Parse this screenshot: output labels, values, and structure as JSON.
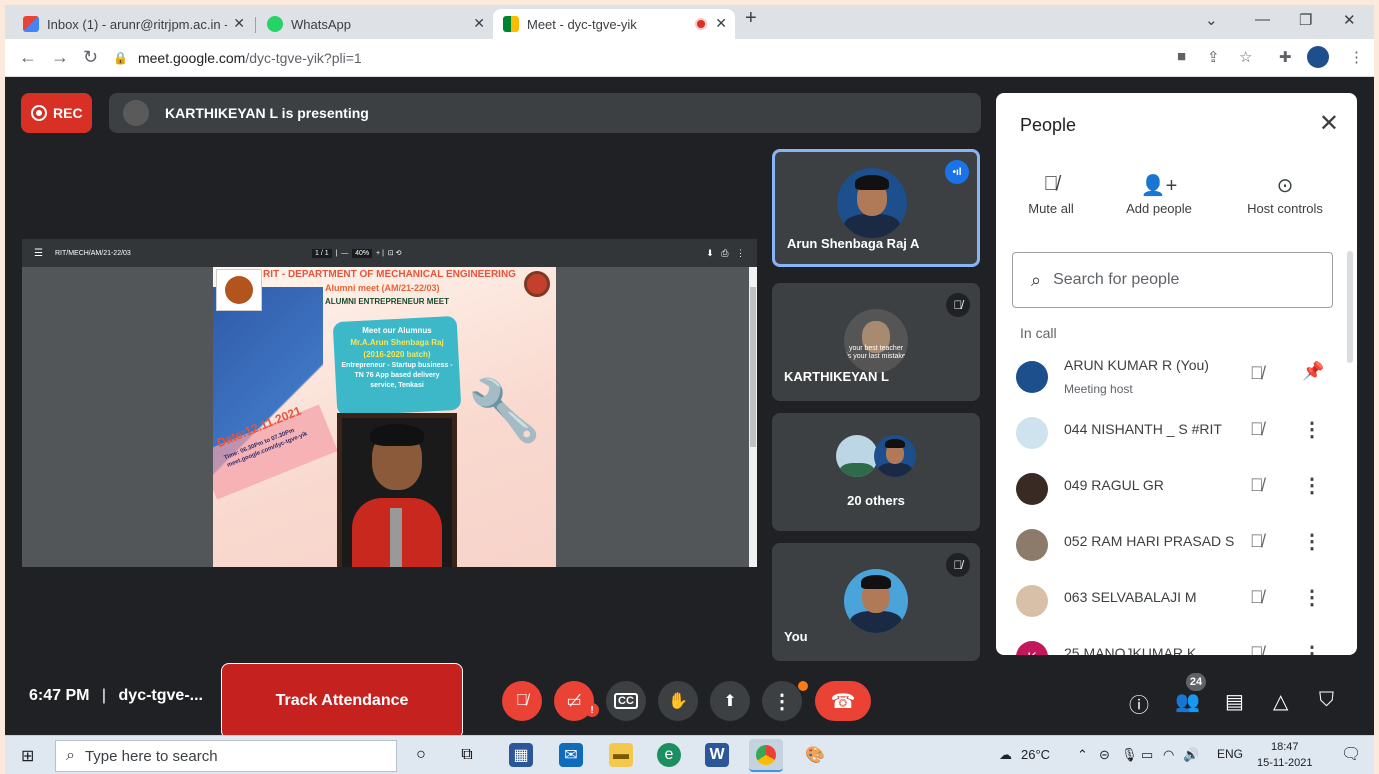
{
  "browser": {
    "tabs": [
      {
        "title": "Inbox (1) - arunr@ritrjpm.ac.in - R",
        "icon": "gmail-icon",
        "active": false
      },
      {
        "title": "WhatsApp",
        "icon": "whatsapp-icon",
        "active": false
      },
      {
        "title": "Meet - dyc-tgve-yik",
        "icon": "meet-icon",
        "active": true
      }
    ],
    "url_host": "meet.google.com",
    "url_path": "/dyc-tgve-yik?pli=1"
  },
  "meet": {
    "rec_label": "REC",
    "presenting_text": "KARTHIKEYAN L is presenting",
    "pdf": {
      "filename": "RIT/MECH/AM/21-22/03",
      "page_indicator": "1 / 1",
      "zoom": "40%",
      "heading": "RIT - DEPARTMENT OF MECHANICAL ENGINEERING",
      "subheading": "Alumni meet (AM/21-22/03)",
      "title": "ALUMNI ENTREPRENEUR MEET",
      "splash_l1": "Meet our Alumnus",
      "splash_l2": "Mr.A.Arun Shenbaga Raj",
      "splash_l3": "(2016-2020 batch)",
      "splash_l4": "Entrepreneur - Startup business - TN 76 App based delivery service, Tenkasi",
      "date": "Date:12.11.2021",
      "time": "Time: 06.30Pm to 07.30Pm",
      "link": "meet.google.com/dyc-tgve-yik"
    },
    "tiles": [
      {
        "name": "Arun Shenbaga Raj A"
      },
      {
        "name": "KARTHIKEYAN L",
        "caption": "your best teacher is your last mistake"
      },
      {
        "name": "20 others"
      },
      {
        "name": "You"
      }
    ],
    "meeting_time": "6:47 PM",
    "meeting_sep": "|",
    "meeting_code": "dyc-tgve-...",
    "track_attendance": "Track Attendance",
    "participants_count": "24"
  },
  "people_panel": {
    "title": "People",
    "actions": [
      {
        "label": "Mute all",
        "icon": "mic-off-icon"
      },
      {
        "label": "Add people",
        "icon": "person-add-icon"
      },
      {
        "label": "Host controls",
        "icon": "toggle-icon"
      }
    ],
    "search_placeholder": "Search for people",
    "section_label": "In call",
    "participants": [
      {
        "name": "ARUN KUMAR R (You)",
        "sub": "Meeting host"
      },
      {
        "name": "044 NISHANTH _ S #RIT",
        "sub": ""
      },
      {
        "name": "049 RAGUL GR",
        "sub": ""
      },
      {
        "name": "052 RAM HARI PRASAD S",
        "sub": ""
      },
      {
        "name": "063 SELVABALAJI M",
        "sub": ""
      },
      {
        "name": "25 MANOJKUMAR K",
        "sub": ""
      }
    ],
    "last_avatar_letter": "K"
  },
  "taskbar": {
    "search_placeholder": "Type here to search",
    "weather": "26°C",
    "language": "ENG",
    "time": "18:47",
    "date": "15-11-2021"
  },
  "colors": {
    "meet_bg": "#202124",
    "tile_bg": "#3c4043",
    "danger": "#ea4335",
    "track": "#c5221f",
    "accent": "#8ab4f8"
  }
}
